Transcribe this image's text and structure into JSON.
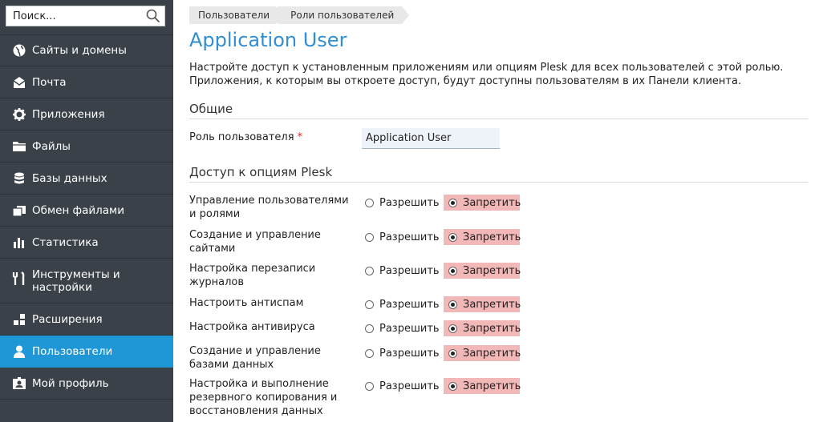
{
  "search": {
    "placeholder": "Поиск..."
  },
  "nav": [
    {
      "label": "Сайты и домены",
      "icon": "globe-icon"
    },
    {
      "label": "Почта",
      "icon": "envelope-icon"
    },
    {
      "label": "Приложения",
      "icon": "gear-icon"
    },
    {
      "label": "Файлы",
      "icon": "folder-icon"
    },
    {
      "label": "Базы данных",
      "icon": "database-icon"
    },
    {
      "label": "Обмен файлами",
      "icon": "file-sharing-icon"
    },
    {
      "label": "Статистика",
      "icon": "bar-chart-icon"
    },
    {
      "label": "Инструменты и настройки",
      "icon": "tools-icon"
    },
    {
      "label": "Расширения",
      "icon": "extensions-icon"
    },
    {
      "label": "Пользователи",
      "icon": "user-icon",
      "active": true
    },
    {
      "label": "Мой профиль",
      "icon": "profile-card-icon"
    }
  ],
  "breadcrumbs": [
    "Пользователи",
    "Роли пользователей"
  ],
  "page_title": "Application User",
  "description": "Настройте доступ к установленным приложениям или опциям Plesk для всех пользователей с этой ролью. Приложения, к которым вы откроете доступ, будут доступны пользователям в их Панели клиента.",
  "general": {
    "heading": "Общие",
    "role_label": "Роль пользователя",
    "required_mark": "*",
    "role_value": "Application User"
  },
  "access": {
    "heading": "Доступ к опциям Plesk",
    "allow_label": "Разрешить",
    "deny_label": "Запретить",
    "options": [
      {
        "label": "Управление пользователями и ролями",
        "value": "deny"
      },
      {
        "label": "Создание и управление сайтами",
        "value": "deny"
      },
      {
        "label": "Настройка перезаписи журналов",
        "value": "deny"
      },
      {
        "label": "Настроить антиспам",
        "value": "deny"
      },
      {
        "label": "Настройка антивируса",
        "value": "deny"
      },
      {
        "label": "Создание и управление базами данных",
        "value": "deny"
      },
      {
        "label": "Настройка и выполнение резервного копирования и восстановления данных",
        "value": "deny"
      }
    ]
  },
  "colors": {
    "sidebar_bg": "#3a4149",
    "active_item": "#1f97d6",
    "title": "#2f8fd0",
    "deny_bg": "#f2b8b8"
  }
}
